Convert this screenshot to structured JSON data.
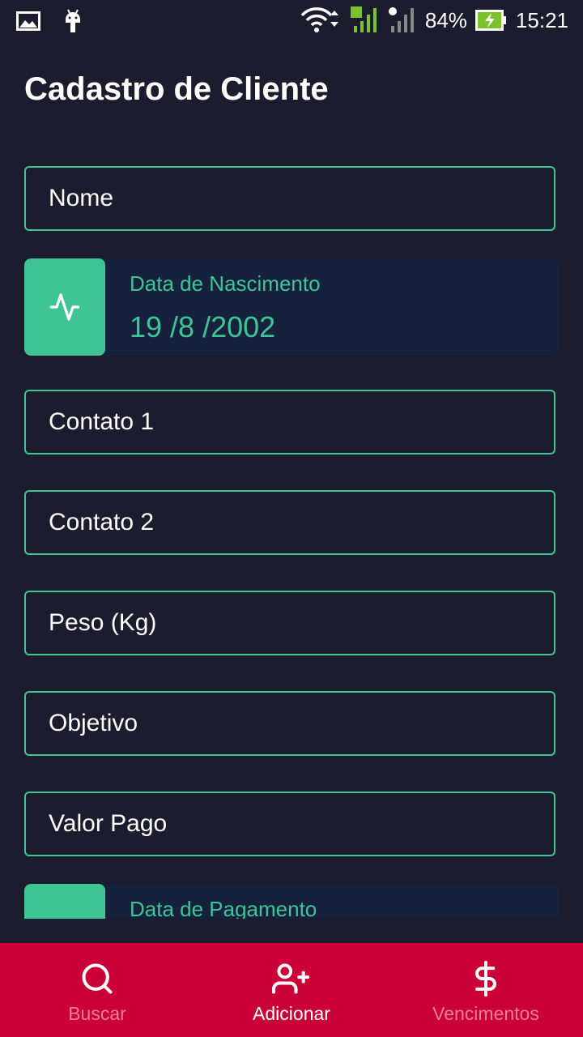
{
  "status_bar": {
    "battery": "84%",
    "time": "15:21"
  },
  "page": {
    "title": "Cadastro de Cliente"
  },
  "form": {
    "nome": "Nome",
    "data_nascimento": {
      "label": "Data de Nascimento",
      "value": "19 /8 /2002"
    },
    "contato1": "Contato 1",
    "contato2": "Contato 2",
    "peso": "Peso (Kg)",
    "objetivo": "Objetivo",
    "valor_pago": "Valor Pago",
    "data_pagamento": {
      "label": "Data de Pagamento"
    }
  },
  "bottom_nav": {
    "items": [
      {
        "label": "Buscar",
        "icon": "search-icon",
        "active": false
      },
      {
        "label": "Adicionar",
        "icon": "user-plus-icon",
        "active": true
      },
      {
        "label": "Vencimentos",
        "icon": "dollar-icon",
        "active": false
      }
    ]
  },
  "colors": {
    "background": "#1b1c2e",
    "accent": "#3ec495",
    "card": "#16213e",
    "nav": "#cc0039"
  }
}
